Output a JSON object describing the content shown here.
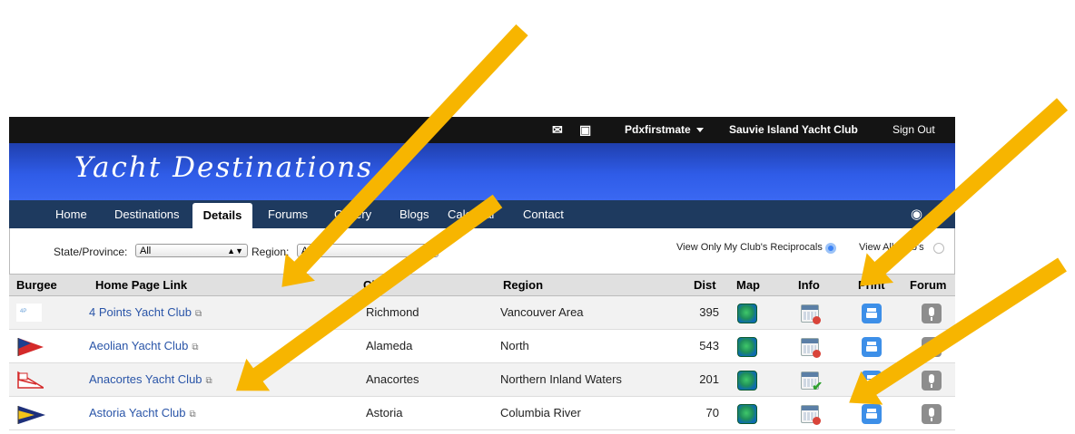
{
  "topbar": {
    "user_menu": "Pdxfirstmate",
    "club": "Sauvie Island Yacht Club",
    "signout": "Sign Out"
  },
  "brand": "Yacht Destinations",
  "nav": {
    "items": [
      "Home",
      "Destinations",
      "Details",
      "Forums",
      "Gallery",
      "Blogs",
      "Calendar",
      "Contact"
    ],
    "active": "Details"
  },
  "filters": {
    "state_label": "State/Province:",
    "state_value": "All",
    "region_label": "Region:",
    "region_value": "All",
    "view_reciprocals": "View Only My Club's Reciprocals",
    "view_all": "View All Club's",
    "selected_view": "reciprocals"
  },
  "table": {
    "headers": [
      "Burgee",
      "Home Page Link",
      "City",
      "Region",
      "Dist",
      "Map",
      "Info",
      "Print",
      "Forum"
    ],
    "rows": [
      {
        "name": "4 Points Yacht Club",
        "city": "Richmond",
        "region": "Vancouver Area",
        "dist": "395",
        "info": "unavailable"
      },
      {
        "name": "Aeolian Yacht Club",
        "city": "Alameda",
        "region": "North",
        "dist": "543",
        "info": "unavailable"
      },
      {
        "name": "Anacortes Yacht Club",
        "city": "Anacortes",
        "region": "Northern Inland Waters",
        "dist": "201",
        "info": "available"
      },
      {
        "name": "Astoria Yacht Club",
        "city": "Astoria",
        "region": "Columbia River",
        "dist": "70",
        "info": "unavailable"
      }
    ]
  },
  "colors": {
    "banner": "#2f5ce8",
    "nav": "#1e3a5f",
    "annotation_arrow": "#f7b500",
    "link": "#2a55a8"
  }
}
